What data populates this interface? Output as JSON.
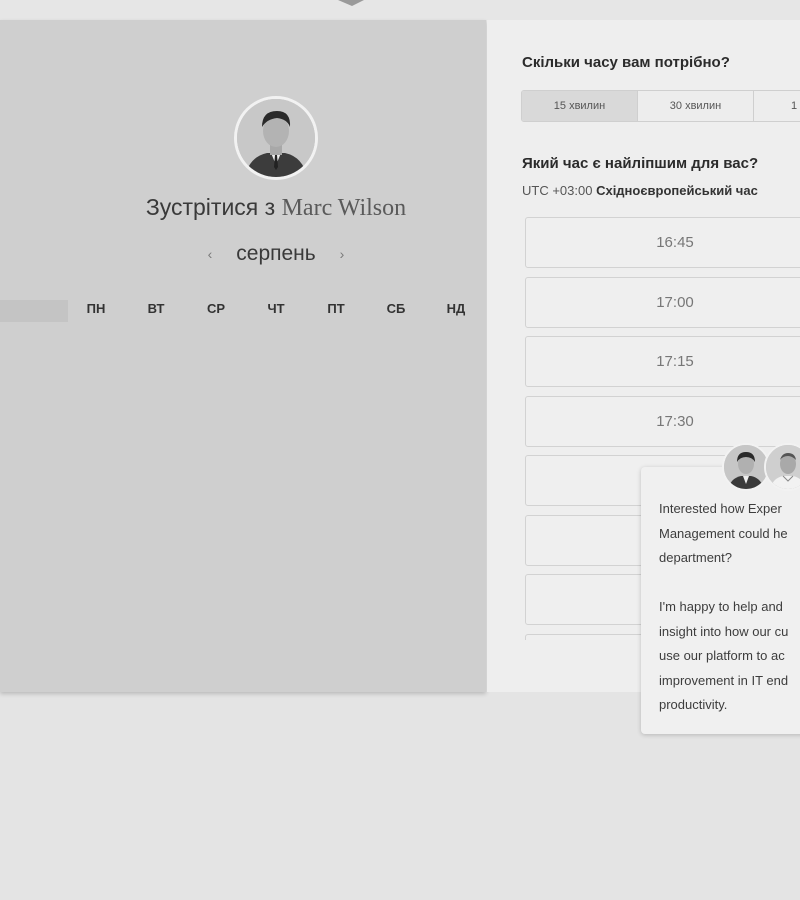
{
  "booking": {
    "title_prefix": "Зустрітися з",
    "host_name": "Marc Wilson",
    "month": "серпень",
    "weekdays": [
      "ПН",
      "ВТ",
      "СР",
      "ЧТ",
      "ПТ",
      "СБ",
      "НД"
    ]
  },
  "duration": {
    "question": "Скільки часу вам потрібно?",
    "options": [
      "15 хвилин",
      "30 хвилин",
      "1"
    ],
    "selected": "15 хвилин"
  },
  "time": {
    "question": "Який час є найліпшим для вас?",
    "tz_offset": "UTC +03:00",
    "tz_name": "Східноєвропейський час",
    "slots": [
      "16:45",
      "17:00",
      "17:15",
      "17:30",
      "",
      "",
      "",
      ""
    ]
  },
  "chat": {
    "message": "Interested how Exper\nManagement could he\ndepartment?\n\nI'm happy to help and\ninsight into how our cu\nuse our platform to ac\nimprovement in IT end\nproductivity."
  },
  "icons": {
    "prev": "chevron-left-icon",
    "next": "chevron-right-icon"
  }
}
